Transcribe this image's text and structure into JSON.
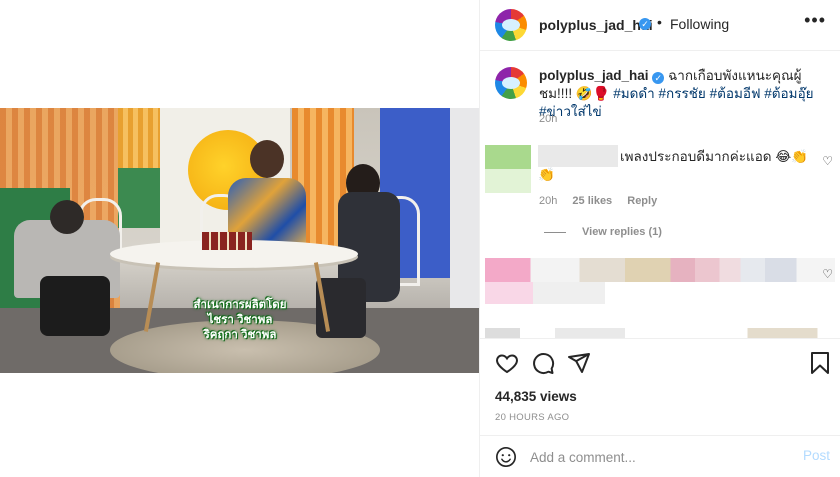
{
  "header": {
    "username": "polyplus_jad_hai",
    "verified_icon": "verified-badge-icon",
    "separator": "•",
    "follow_status": "Following",
    "more_icon": "more-options-icon",
    "more_label": "•••"
  },
  "media": {
    "subtitle_line1": "สำเนาการผลิตโดย",
    "subtitle_line2": "ไชรา วิชาพล",
    "subtitle_line3": "ริคฤกา วิชาพล"
  },
  "caption": {
    "username": "polyplus_jad_hai",
    "text": "ฉากเกือบพังแหนะคุณผู้ชม!!!!",
    "emoji": "🤣🥊",
    "hashtags": [
      "#มดดำ",
      "#กรรชัย",
      "#ต้อมอีฟ",
      "#ต้อมอุ๊ย",
      "#ข่าวใส่ไข่"
    ],
    "time": "20h"
  },
  "comment": {
    "text": "เพลงประกอบดีมากค่ะแอด 😂👏 👏",
    "time": "20h",
    "likes": "25 likes",
    "reply_label": "Reply",
    "view_replies": "View replies (1)"
  },
  "actions": {
    "like_icon": "heart-outline-icon",
    "comment_icon": "comment-bubble-icon",
    "share_icon": "paper-plane-icon",
    "save_icon": "bookmark-icon",
    "views": "44,835 views",
    "posted": "20 HOURS AGO"
  },
  "add_comment": {
    "emoji_icon": "emoji-smiley-icon",
    "placeholder": "Add a comment...",
    "post_label": "Post"
  },
  "colors": {
    "link": "#00376b",
    "muted": "#8e8e8e",
    "verified": "#3897f0",
    "post_disabled": "#b3dbff"
  }
}
